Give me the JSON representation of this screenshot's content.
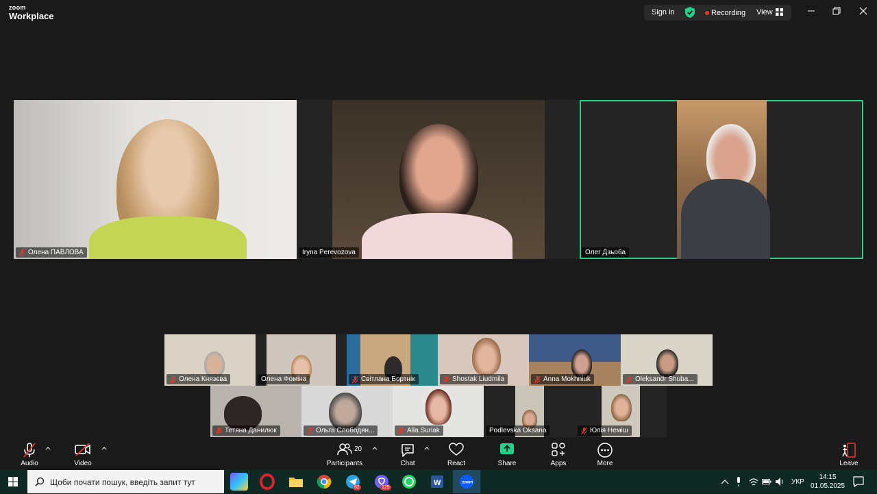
{
  "app": {
    "logo_top": "zoom",
    "logo_bottom": "Workplace"
  },
  "titlebar": {
    "sign_in": "Sign in",
    "recording": "Recording",
    "view": "View"
  },
  "speakers": [
    {
      "name": "Олена ПАВЛОВА",
      "muted": true
    },
    {
      "name": "Iryna Perevozova",
      "muted": false
    },
    {
      "name": "Олег Дзьоба",
      "muted": false,
      "active": true
    }
  ],
  "gallery_row1": [
    {
      "name": "Олена Князєва",
      "muted": true
    },
    {
      "name": "Олена Фоміна",
      "muted": false
    },
    {
      "name": "Світлана Бортнік",
      "muted": true
    },
    {
      "name": "Shostak Liudmila",
      "muted": true
    },
    {
      "name": "Anna Mokhniuk",
      "muted": true
    },
    {
      "name": "Oleksandr Shuba...",
      "muted": true
    }
  ],
  "gallery_row2": [
    {
      "name": "Тетяна Данилюк",
      "muted": true
    },
    {
      "name": "Ольга Слободян...",
      "muted": true
    },
    {
      "name": "Alla Suriak",
      "muted": true
    },
    {
      "name": "Podlevska Oksana",
      "muted": false
    },
    {
      "name": "Юлія Неміш",
      "muted": true
    }
  ],
  "toolbar": {
    "audio": "Audio",
    "video": "Video",
    "participants": "Participants",
    "participants_count": "20",
    "chat": "Chat",
    "react": "React",
    "share": "Share",
    "apps": "Apps",
    "more": "More",
    "leave": "Leave"
  },
  "taskbar": {
    "search_placeholder": "Щоби почати пошук, введіть запит тут",
    "telegram_badge": "62",
    "viber_badge": "125",
    "language": "УКР",
    "time": "14:15",
    "date": "01.05.2025"
  },
  "colors": {
    "active_speaker": "#23d18b",
    "share": "#23d18b",
    "recording_dot": "#e5372c",
    "leave": "#e5372c"
  }
}
